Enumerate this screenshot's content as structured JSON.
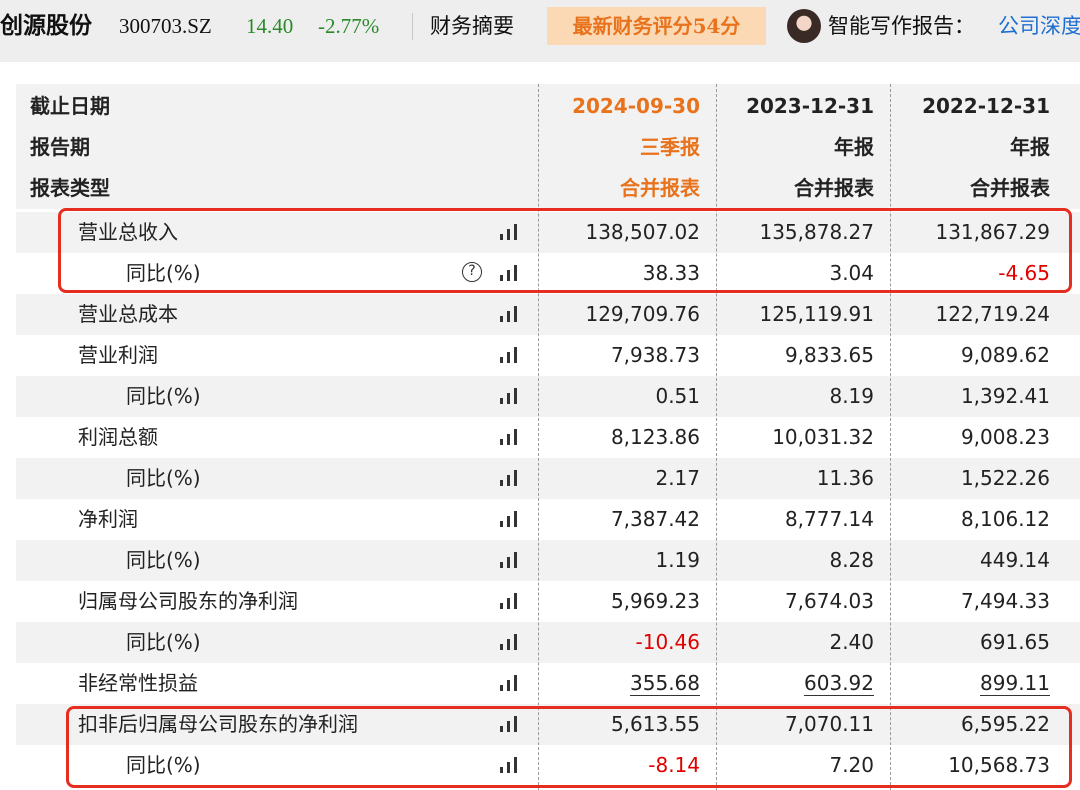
{
  "header": {
    "stock_name": "创源股份",
    "stock_code": "300703.SZ",
    "price": "14.40",
    "change": "-2.77%",
    "fin_summary": "财务摘要",
    "score_badge": "最新财务评分54分",
    "ai_report_label": "智能写作报告：",
    "ai_report_link": "公司深度",
    "colors": {
      "down": "#2a8a2a",
      "accent": "#e8731c",
      "link": "#1e6fd1",
      "negative": "#e00000",
      "highlight": "#e62e20"
    }
  },
  "table": {
    "header_rows": [
      {
        "label": "截止日期",
        "values": [
          "2024-09-30",
          "2023-12-31",
          "2022-12-31"
        ]
      },
      {
        "label": "报告期",
        "values": [
          "三季报",
          "年报",
          "年报"
        ]
      },
      {
        "label": "报表类型",
        "values": [
          "合并报表",
          "合并报表",
          "合并报表"
        ]
      }
    ],
    "rows": [
      {
        "label": "营业总收入",
        "values": [
          "138,507.02",
          "135,878.27",
          "131,867.29"
        ]
      },
      {
        "label": "同比(%)",
        "values": [
          "38.33",
          "3.04",
          "-4.65"
        ]
      },
      {
        "label": "营业总成本",
        "values": [
          "129,709.76",
          "125,119.91",
          "122,719.24"
        ]
      },
      {
        "label": "营业利润",
        "values": [
          "7,938.73",
          "9,833.65",
          "9,089.62"
        ]
      },
      {
        "label": "同比(%)",
        "values": [
          "0.51",
          "8.19",
          "1,392.41"
        ]
      },
      {
        "label": "利润总额",
        "values": [
          "8,123.86",
          "10,031.32",
          "9,008.23"
        ]
      },
      {
        "label": "同比(%)",
        "values": [
          "2.17",
          "11.36",
          "1,522.26"
        ]
      },
      {
        "label": "净利润",
        "values": [
          "7,387.42",
          "8,777.14",
          "8,106.12"
        ]
      },
      {
        "label": "同比(%)",
        "values": [
          "1.19",
          "8.28",
          "449.14"
        ]
      },
      {
        "label": "归属母公司股东的净利润",
        "values": [
          "5,969.23",
          "7,674.03",
          "7,494.33"
        ]
      },
      {
        "label": "同比(%)",
        "values": [
          "-10.46",
          "2.40",
          "691.65"
        ]
      },
      {
        "label": "非经常性损益",
        "values": [
          "355.68",
          "603.92",
          "899.11"
        ]
      },
      {
        "label": "扣非后归属母公司股东的净利润",
        "values": [
          "5,613.55",
          "7,070.11",
          "6,595.22"
        ]
      },
      {
        "label": "同比(%)",
        "values": [
          "-8.14",
          "7.20",
          "10,568.73"
        ]
      }
    ],
    "help_icon_symbol": "?"
  }
}
